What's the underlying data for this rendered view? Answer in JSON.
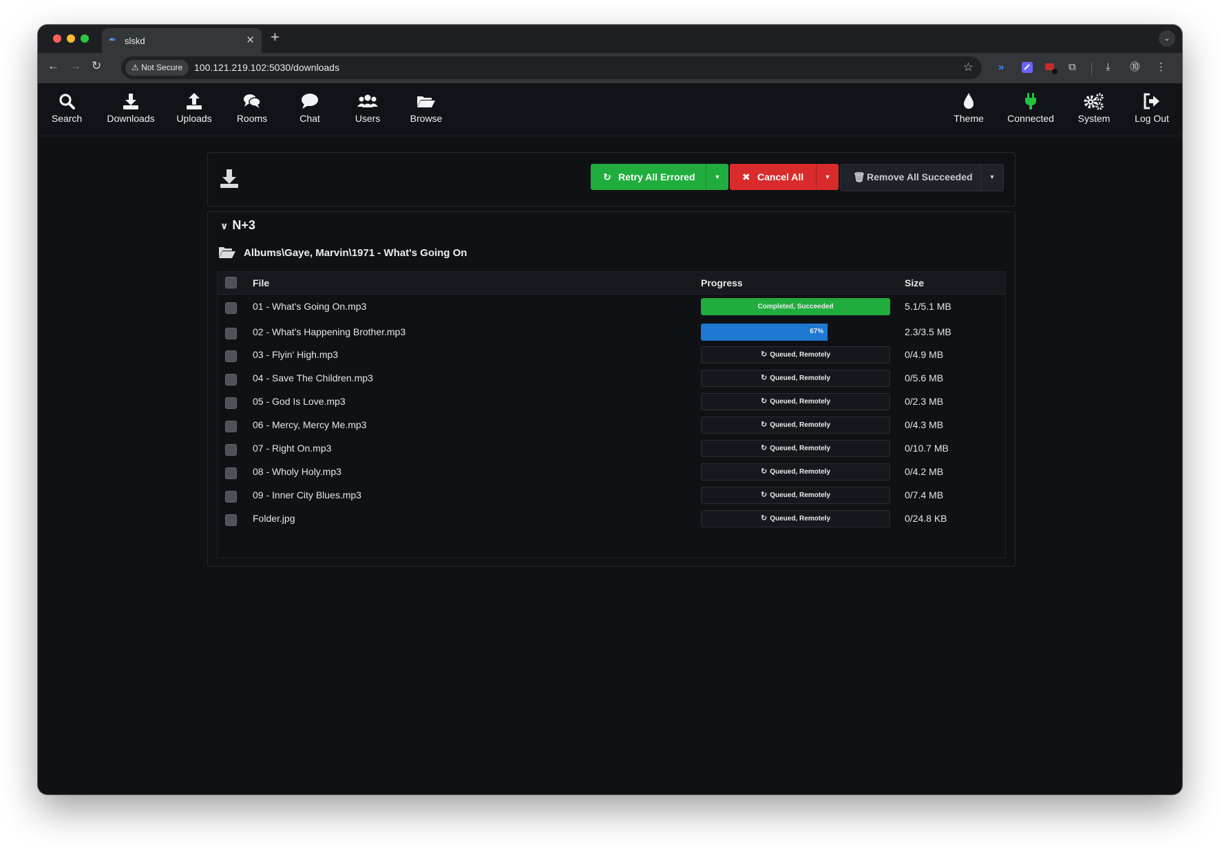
{
  "browser": {
    "tab_title": "slskd",
    "not_secure_label": "Not Secure",
    "url": "100.121.219.102:5030/downloads"
  },
  "nav": {
    "left": [
      {
        "id": "search",
        "label": "Search",
        "icon": "search-icon"
      },
      {
        "id": "downloads",
        "label": "Downloads",
        "icon": "download-icon"
      },
      {
        "id": "uploads",
        "label": "Uploads",
        "icon": "upload-icon"
      },
      {
        "id": "rooms",
        "label": "Rooms",
        "icon": "comments-icon"
      },
      {
        "id": "chat",
        "label": "Chat",
        "icon": "comment-icon"
      },
      {
        "id": "users",
        "label": "Users",
        "icon": "users-icon"
      },
      {
        "id": "browse",
        "label": "Browse",
        "icon": "folder-open-icon"
      }
    ],
    "right": [
      {
        "id": "theme",
        "label": "Theme",
        "icon": "tint-icon"
      },
      {
        "id": "connected",
        "label": "Connected",
        "icon": "plug-icon"
      },
      {
        "id": "system",
        "label": "System",
        "icon": "cogs-icon"
      },
      {
        "id": "logout",
        "label": "Log Out",
        "icon": "sign-out-icon"
      }
    ]
  },
  "actions": {
    "retry_label": "Retry All Errored",
    "cancel_label": "Cancel All",
    "remove_label": "Remove All Succeeded"
  },
  "group": {
    "username": "N+3",
    "directory": "Albums\\Gaye, Marvin\\1971 - What's Going On",
    "columns": {
      "file": "File",
      "progress": "Progress",
      "size": "Size"
    },
    "files": [
      {
        "name": "01 - What's Going On.mp3",
        "status": "Completed, Succeeded",
        "percent": 100,
        "state": "complete",
        "size": "5.1/5.1 MB"
      },
      {
        "name": "02 - What's Happening Brother.mp3",
        "status": "67%",
        "percent": 67,
        "state": "progress",
        "size": "2.3/3.5 MB"
      },
      {
        "name": "03 - Flyin' High.mp3",
        "status": "Queued, Remotely",
        "percent": 0,
        "state": "queued",
        "size": "0/4.9 MB"
      },
      {
        "name": "04 - Save The Children.mp3",
        "status": "Queued, Remotely",
        "percent": 0,
        "state": "queued",
        "size": "0/5.6 MB"
      },
      {
        "name": "05 - God Is Love.mp3",
        "status": "Queued, Remotely",
        "percent": 0,
        "state": "queued",
        "size": "0/2.3 MB"
      },
      {
        "name": "06 - Mercy, Mercy Me.mp3",
        "status": "Queued, Remotely",
        "percent": 0,
        "state": "queued",
        "size": "0/4.3 MB"
      },
      {
        "name": "07 - Right On.mp3",
        "status": "Queued, Remotely",
        "percent": 0,
        "state": "queued",
        "size": "0/10.7 MB"
      },
      {
        "name": "08 - Wholy Holy.mp3",
        "status": "Queued, Remotely",
        "percent": 0,
        "state": "queued",
        "size": "0/4.2 MB"
      },
      {
        "name": "09 - Inner City Blues.mp3",
        "status": "Queued, Remotely",
        "percent": 0,
        "state": "queued",
        "size": "0/7.4 MB"
      },
      {
        "name": "Folder.jpg",
        "status": "Queued, Remotely",
        "percent": 0,
        "state": "queued",
        "size": "0/24.8 KB"
      }
    ]
  },
  "colors": {
    "complete": "#20ad3d",
    "progress": "#1f78d1",
    "green_button": "#20ad3d",
    "red_button": "#d92b2b",
    "connected_icon": "#22c13f"
  }
}
